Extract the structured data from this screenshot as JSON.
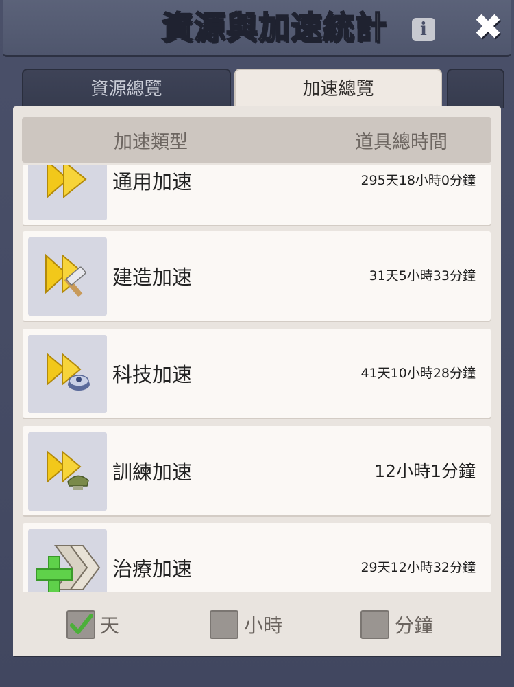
{
  "header": {
    "title": "資源與加速統計",
    "info_label": "i",
    "close_label": "✖"
  },
  "tabs": [
    {
      "label": "資源總覽",
      "active": false
    },
    {
      "label": "加速總覽",
      "active": true
    }
  ],
  "columns": {
    "type": "加速類型",
    "time": "道具總時間"
  },
  "rows": [
    {
      "label": "通用加速",
      "value": "295天18小時0分鐘",
      "icon": "speedup-general-icon"
    },
    {
      "label": "建造加速",
      "value": "31天5小時33分鐘",
      "icon": "speedup-build-icon"
    },
    {
      "label": "科技加速",
      "value": "41天10小時28分鐘",
      "icon": "speedup-research-icon"
    },
    {
      "label": "訓練加速",
      "value": "12小時1分鐘",
      "icon": "speedup-training-icon"
    },
    {
      "label": "治療加速",
      "value": "29天12小時32分鐘",
      "icon": "speedup-healing-icon"
    }
  ],
  "filters": [
    {
      "label": "天",
      "checked": true
    },
    {
      "label": "小時",
      "checked": false
    },
    {
      "label": "分鐘",
      "checked": false
    }
  ],
  "colors": {
    "accent_yellow": "#f2c81a",
    "check_green": "#4caf3a",
    "panel_bg": "#e9e4df"
  }
}
